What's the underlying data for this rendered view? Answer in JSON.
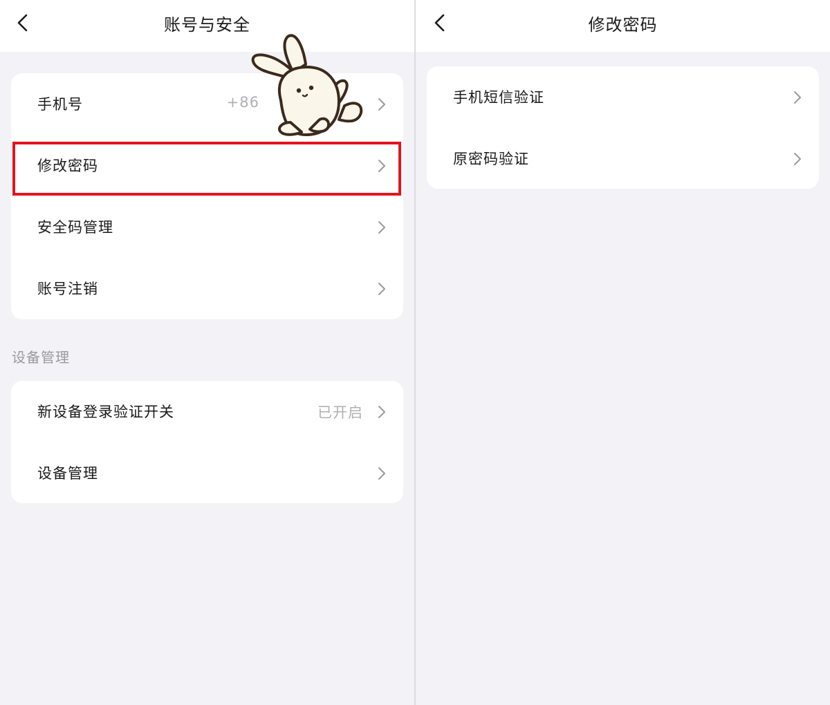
{
  "left": {
    "title": "账号与安全",
    "main_items": [
      {
        "label": "手机号",
        "value": "+86"
      },
      {
        "label": "修改密码",
        "value": ""
      },
      {
        "label": "安全码管理",
        "value": ""
      },
      {
        "label": "账号注销",
        "value": ""
      }
    ],
    "device_section": {
      "header": "设备管理",
      "items": [
        {
          "label": "新设备登录验证开关",
          "value": "已开启"
        },
        {
          "label": "设备管理",
          "value": ""
        }
      ]
    }
  },
  "right": {
    "title": "修改密码",
    "items": [
      {
        "label": "手机短信验证"
      },
      {
        "label": "原密码验证"
      }
    ]
  },
  "colors": {
    "background": "#f2f2f7",
    "card": "#ffffff",
    "highlight": "#e3141e",
    "secondary_text": "#b0b0b3"
  },
  "icons": {
    "back": "chevron-left-icon",
    "row_arrow": "chevron-right-icon",
    "sticker": "bunny-sticker"
  }
}
